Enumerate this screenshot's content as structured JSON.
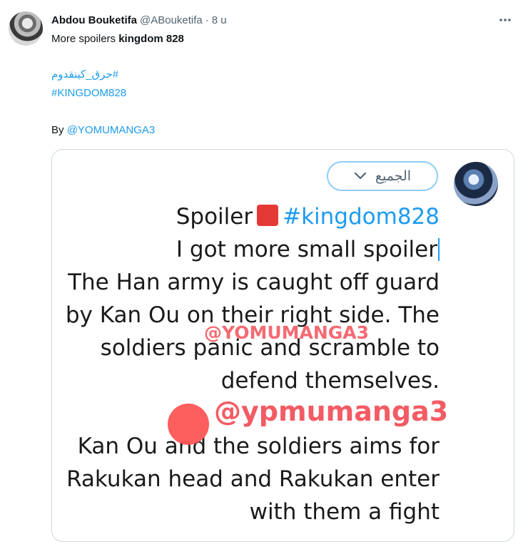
{
  "tweet": {
    "display_name": "Abdou Bouketifa",
    "handle": "@ABouketifa",
    "separator": "·",
    "time": "8 u",
    "more_icon": "more-horizontal-icon",
    "text_prefix": "More spoilers ",
    "text_bold": "kingdom 828",
    "hashtag_arabic": "#حرق_كينقدوم",
    "hashtag_kingdom": "#KINGDOM828",
    "by_prefix": "By ",
    "by_mention": "@YOMUMANGA3"
  },
  "media": {
    "dropdown_label": "الجميع",
    "dropdown_icon": "chevron-down-icon",
    "spoiler_word": "Spoiler",
    "spoiler_hashtag": "#kingdom828",
    "lines": [
      "I got more  small spoiler",
      "The Han army is caught off guard",
      "by Kan Ou on their right side. The",
      "soldiers panic and scramble to",
      "defend themselves.",
      "Kan Ou and the soldiers aims for",
      "Rakukan head and Rakukan enter",
      "with them a fight"
    ],
    "watermark_small": "@YOMUMANGA3",
    "watermark_large": "@ypmumanga3",
    "colors": {
      "link": "#1d9bf0",
      "watermark": "#f45b63",
      "red_square": "#e53935"
    }
  }
}
